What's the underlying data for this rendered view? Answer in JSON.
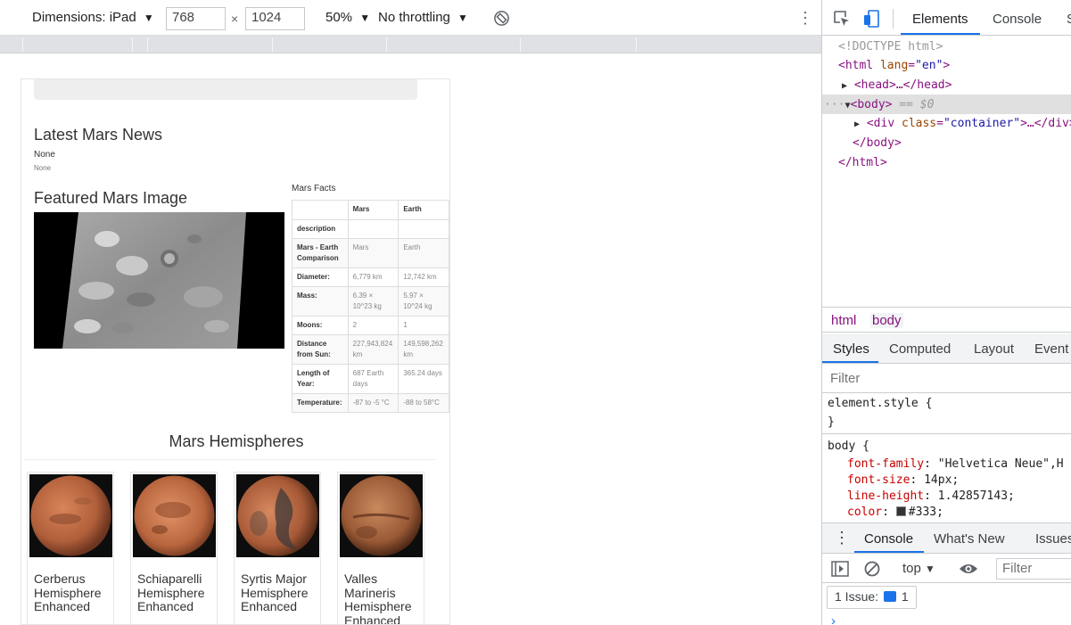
{
  "device_toolbar": {
    "dimensions_label": "Dimensions: iPad",
    "width_value": "768",
    "times": "×",
    "height_value": "1024",
    "zoom": "50%",
    "throttling": "No throttling",
    "caret": "▼",
    "more": "⋮"
  },
  "page": {
    "news_title": "Latest Mars News",
    "news_headline": "None",
    "news_teaser": "None",
    "featured_title": "Featured Mars Image",
    "facts_title": "Mars Facts",
    "facts_table": {
      "headers": [
        "",
        "Mars",
        "Earth"
      ],
      "rows": [
        [
          "description",
          "",
          ""
        ],
        [
          "Mars - Earth Comparison",
          "Mars",
          "Earth"
        ],
        [
          "Diameter:",
          "6,779 km",
          "12,742 km"
        ],
        [
          "Mass:",
          "6.39 × 10^23 kg",
          "5.97 × 10^24 kg"
        ],
        [
          "Moons:",
          "2",
          "1"
        ],
        [
          "Distance from Sun:",
          "227,943,824 km",
          "149,598,262 km"
        ],
        [
          "Length of Year:",
          "687 Earth days",
          "365.24 days"
        ],
        [
          "Temperature:",
          "-87 to -5 °C",
          "-88 to 58°C"
        ]
      ]
    },
    "hemispheres_title": "Mars Hemispheres",
    "hemispheres": [
      {
        "title": "Cerberus Hemisphere Enhanced"
      },
      {
        "title": "Schiaparelli Hemisphere Enhanced"
      },
      {
        "title": "Syrtis Major Hemisphere Enhanced"
      },
      {
        "title": "Valles Marineris Hemisphere Enhanced"
      }
    ]
  },
  "devtools": {
    "tabs": [
      "Elements",
      "Console",
      "S"
    ],
    "active_tab": "Elements",
    "dom": {
      "doctype": "<!DOCTYPE html>",
      "html_open_tag": "<html",
      "lang_attr": "lang",
      "lang_val": "\"en\"",
      "close_bracket": ">",
      "head": "<head>…</head>",
      "body_open": "<body>",
      "body_marker": "== $0",
      "dots": "···",
      "div_open": "<div",
      "class_attr": "class",
      "class_val": "\"container\"",
      "div_rest": ">…</div>",
      "body_close": "</body>",
      "html_close": "</html>"
    },
    "breadcrumbs": [
      "html",
      "body"
    ],
    "style_tabs": [
      "Styles",
      "Computed",
      "Layout",
      "Event"
    ],
    "filter_placeholder": "Filter",
    "styles": {
      "element_style": "element.style {",
      "close": "}",
      "body_selector": "body {",
      "props": [
        {
          "name": "font-family",
          "value": "\"Helvetica Neue\",H"
        },
        {
          "name": "font-size",
          "value": "14px;"
        },
        {
          "name": "line-height",
          "value": "1.42857143;"
        },
        {
          "name": "color",
          "value": "#333;"
        }
      ]
    },
    "drawer": {
      "tabs": [
        "Console",
        "What's New",
        "Issues"
      ],
      "context": "top",
      "filter_placeholder": "Filter",
      "issues_label": "1 Issue:",
      "issues_count": "1",
      "prompt": "›"
    }
  }
}
